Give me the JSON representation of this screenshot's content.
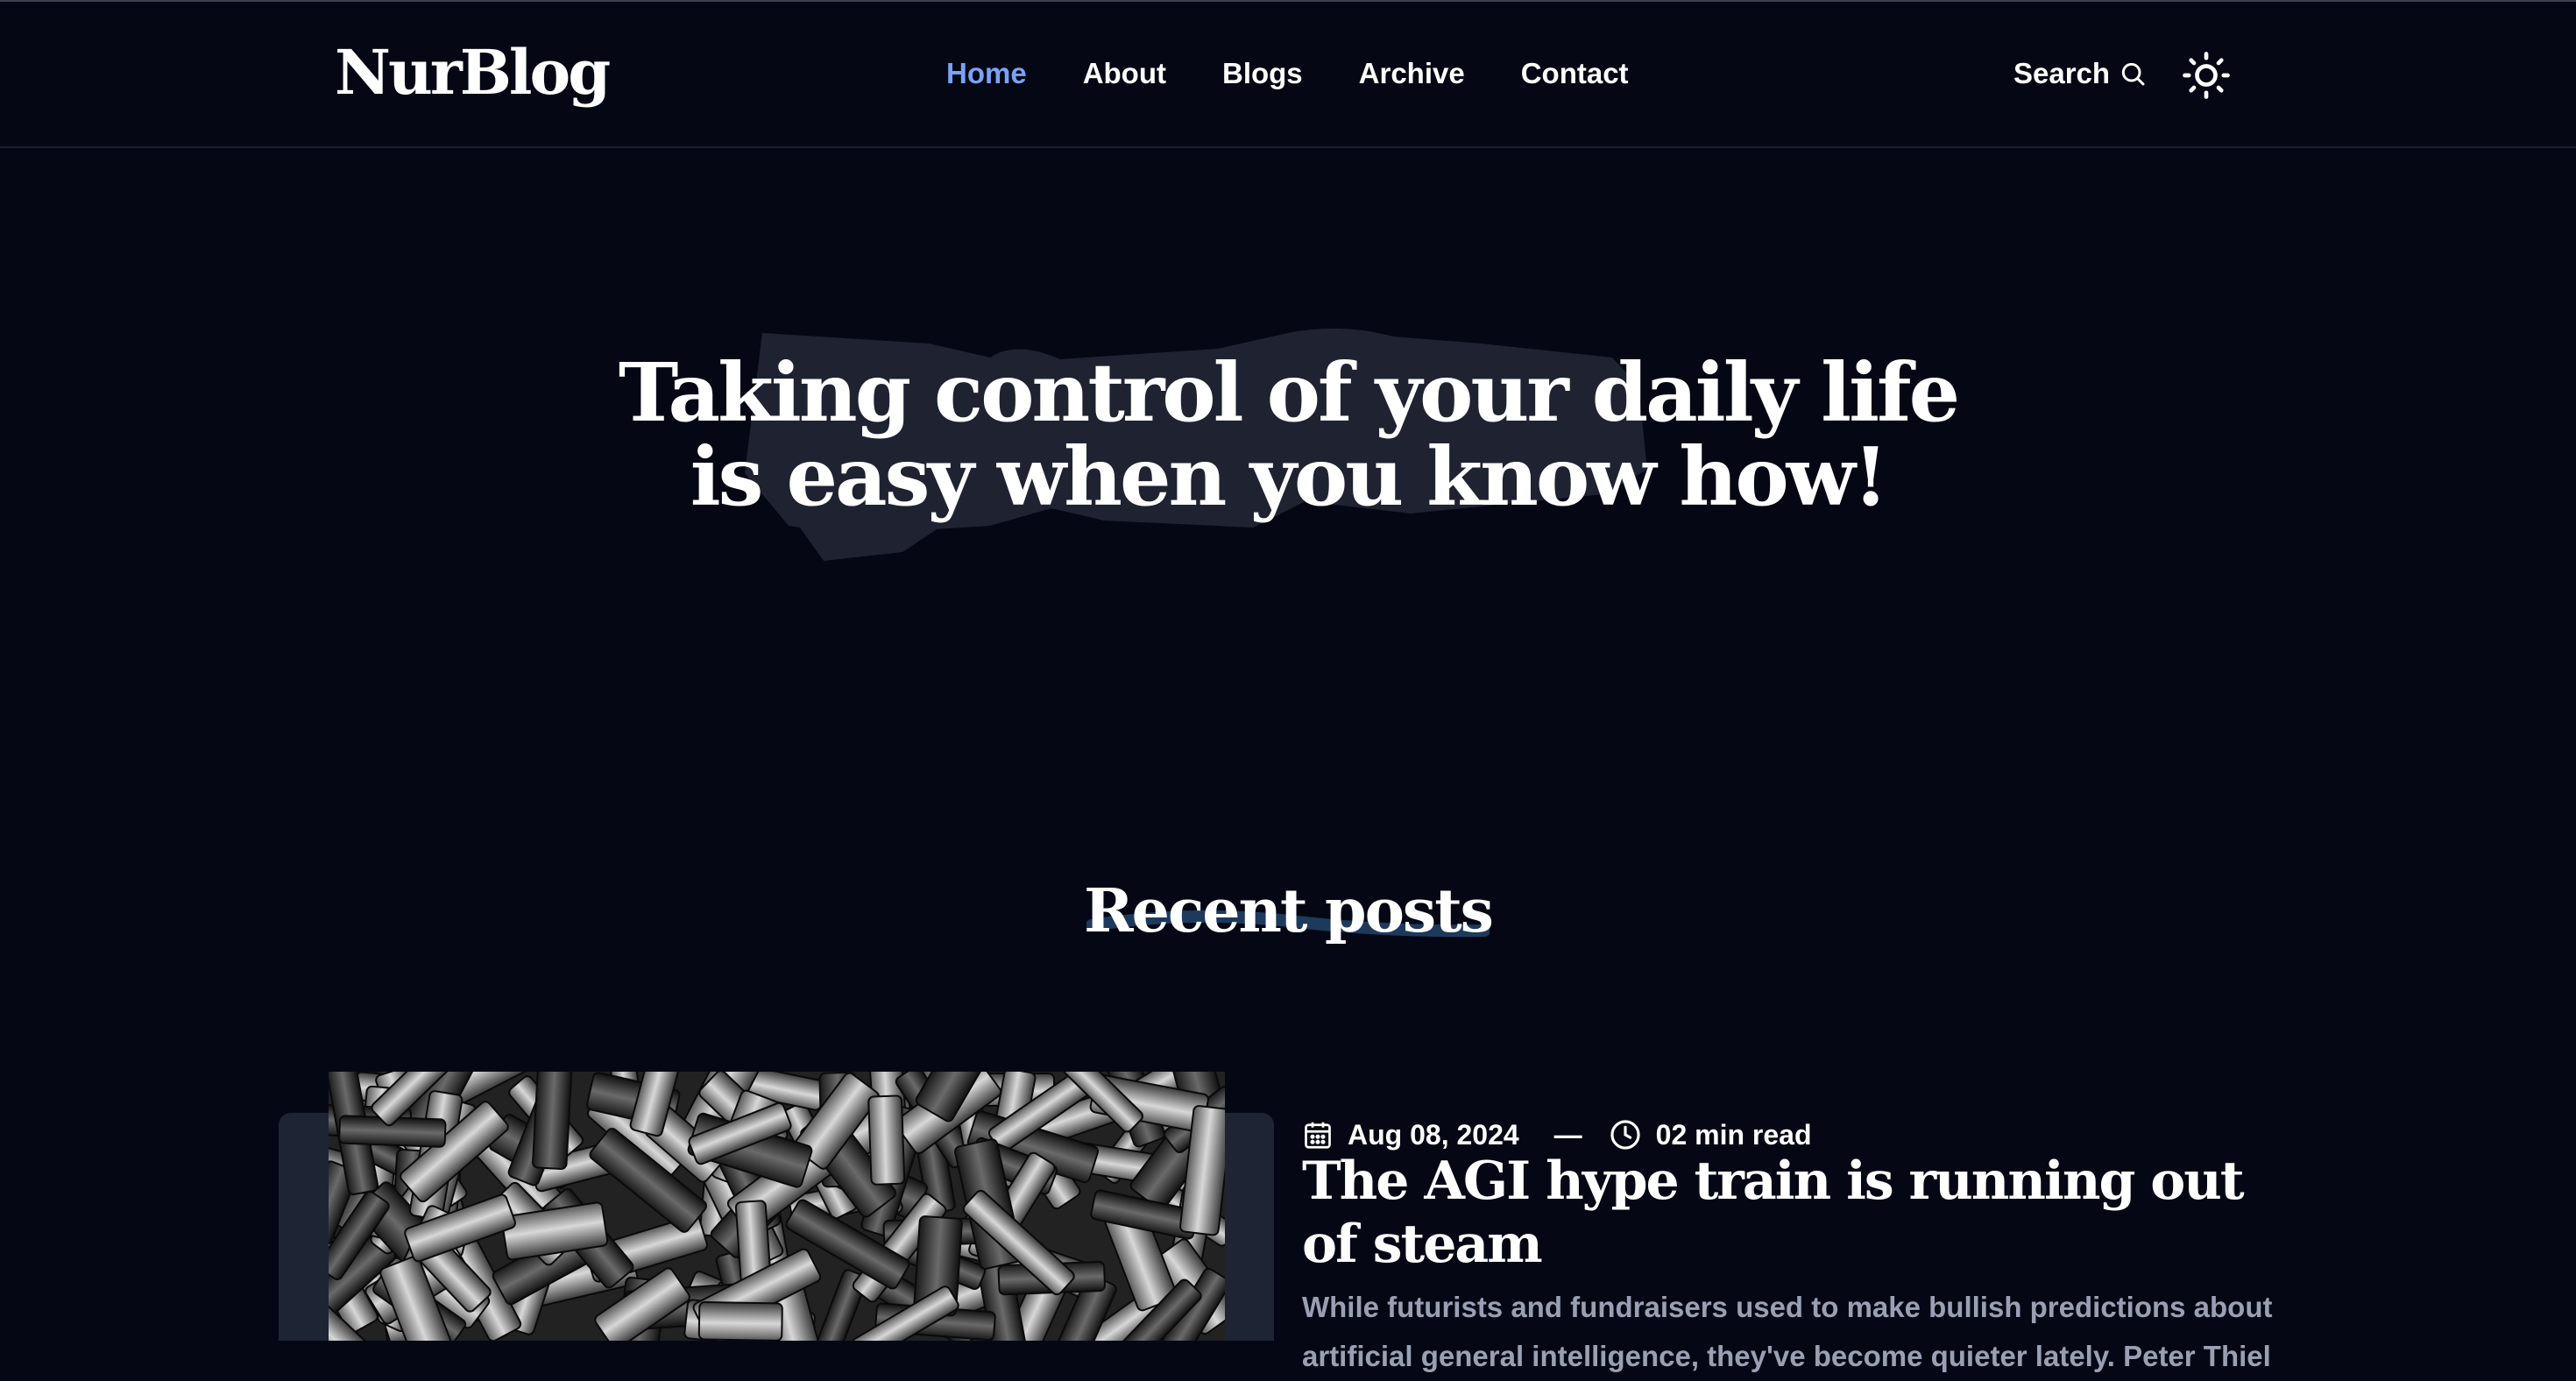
{
  "header": {
    "logo": "NurBlog",
    "nav": [
      {
        "label": "Home",
        "active": true
      },
      {
        "label": "About",
        "active": false
      },
      {
        "label": "Blogs",
        "active": false
      },
      {
        "label": "Archive",
        "active": false
      },
      {
        "label": "Contact",
        "active": false
      }
    ],
    "search_label": "Search",
    "search_icon": "search-icon",
    "theme_icon": "sun-icon"
  },
  "hero": {
    "line1": "Taking control of your daily life",
    "line2": "is easy when you know how!"
  },
  "recent": {
    "heading": "Recent posts"
  },
  "posts": [
    {
      "date": "Aug 08, 2024",
      "separator": "—",
      "read_time": "02 min read",
      "title": "The AGI hype train is running out of steam",
      "excerpt": "While futurists and fundraisers used to make bullish predictions about artificial general intelligence, they've become quieter lately. Peter Thiel"
    }
  ],
  "colors": {
    "background": "#050814",
    "accent": "#7aa2f7",
    "brush": "#1f2331",
    "card": "#1f2435",
    "muted_text": "#9aa0b4",
    "swash": "#1d3a5c"
  }
}
